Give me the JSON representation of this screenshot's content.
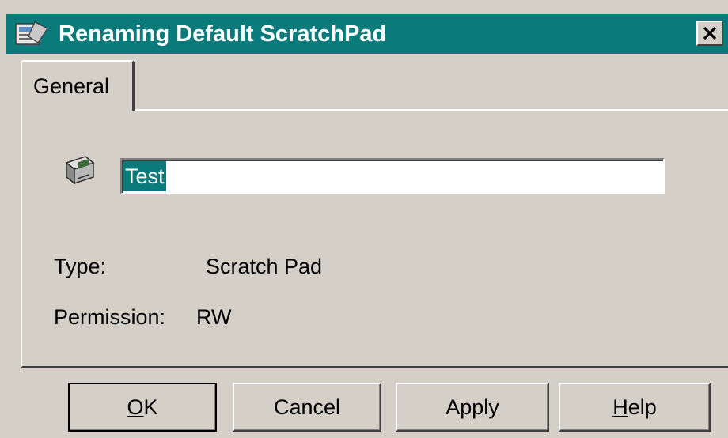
{
  "window": {
    "title": "Renaming Default ScratchPad",
    "close_symbol": "✕"
  },
  "tabs": [
    {
      "label": "General",
      "active": true
    }
  ],
  "general": {
    "name_value": "Test",
    "type_label": "Type:",
    "type_value": "Scratch Pad",
    "permission_label": "Permission:",
    "permission_value": "RW"
  },
  "buttons": {
    "ok": {
      "accel": "O",
      "rest": "K"
    },
    "cancel": {
      "label": "Cancel"
    },
    "apply": {
      "label": "Apply"
    },
    "help": {
      "accel": "H",
      "rest": "elp"
    }
  },
  "icons": {
    "title": "scratchpad-window-icon",
    "item": "scratchpad-icon",
    "close": "close-icon"
  },
  "colors": {
    "titlebar": "#0b7a7a",
    "dialog_bg": "#d4d0c8",
    "selection": "#0b7a7a"
  }
}
